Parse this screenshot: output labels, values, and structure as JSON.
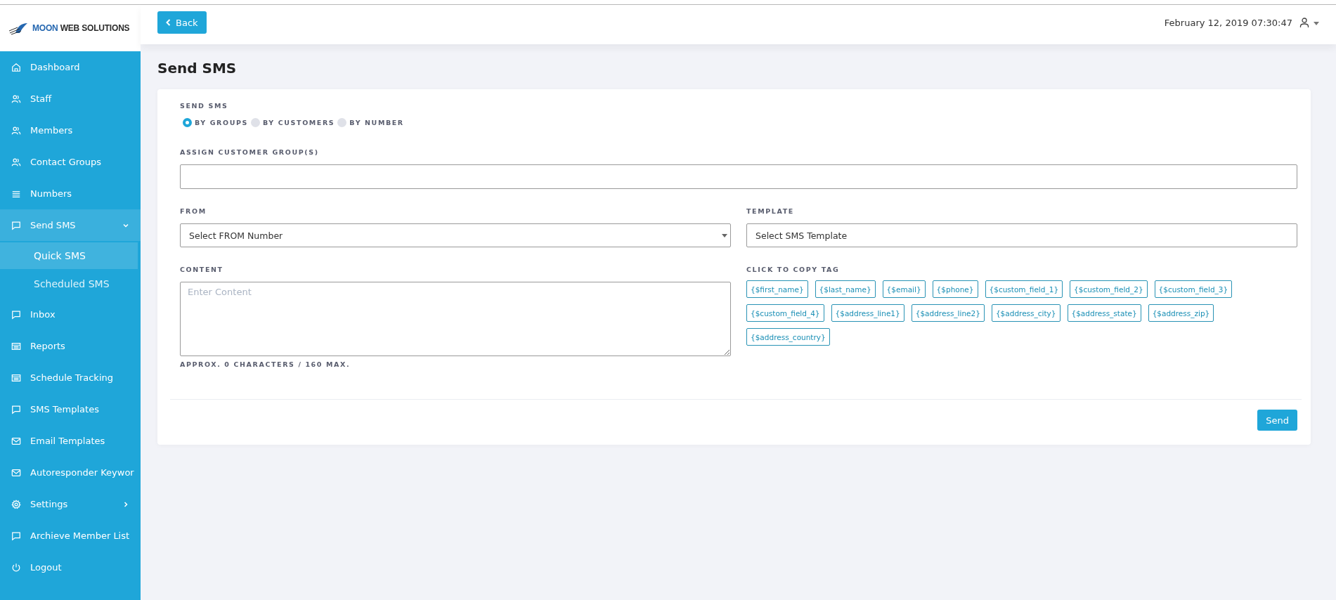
{
  "logo": {
    "brand": "MOON",
    "rest": "WEB SOLUTIONS"
  },
  "header": {
    "back_button": "Back",
    "datetime": "February 12, 2019 07:30:47"
  },
  "sidebar": {
    "items": [
      {
        "label": "Dashboard",
        "kind": "home",
        "selected": false
      },
      {
        "label": "Staff",
        "kind": "users",
        "selected": false
      },
      {
        "label": "Members",
        "kind": "users",
        "selected": false
      },
      {
        "label": "Contact Groups",
        "kind": "users",
        "selected": false
      },
      {
        "label": "Numbers",
        "kind": "lines",
        "selected": false
      },
      {
        "label": "Send SMS",
        "kind": "chat",
        "selected": true,
        "expanded": true,
        "children": [
          {
            "label": "Quick SMS",
            "selected": true
          },
          {
            "label": "Scheduled SMS",
            "selected": false
          }
        ]
      },
      {
        "label": "Inbox",
        "kind": "chat",
        "selected": false
      },
      {
        "label": "Reports",
        "kind": "table",
        "selected": false
      },
      {
        "label": "Schedule Tracking",
        "kind": "table",
        "selected": false
      },
      {
        "label": "SMS Templates",
        "kind": "chat",
        "selected": false
      },
      {
        "label": "Email Templates",
        "kind": "mail",
        "selected": false
      },
      {
        "label": "Autoresponder Keywor",
        "kind": "mail",
        "selected": false
      },
      {
        "label": "Settings",
        "kind": "gear",
        "selected": false,
        "expanded": false
      },
      {
        "label": "Archieve Member List",
        "kind": "chat",
        "selected": false
      },
      {
        "label": "Logout",
        "kind": "power",
        "selected": false
      }
    ]
  },
  "page": {
    "title": "Send SMS"
  },
  "form": {
    "mode_label": "SEND SMS",
    "modes": [
      {
        "label": "BY GROUPS",
        "selected": true
      },
      {
        "label": "BY CUSTOMERS",
        "selected": false
      },
      {
        "label": "BY NUMBER",
        "selected": false
      }
    ],
    "group_label": "ASSIGN CUSTOMER GROUP(S)",
    "from_label": "FROM",
    "from_select": "Select FROM Number",
    "template_label": "TEMPLATE",
    "template_select": "Select SMS Template",
    "content_label": "CONTENT",
    "content_placeholder": "Enter Content",
    "counter": "APPROX. 0 CHARACTERS / 160 MAX.",
    "tags_label": "CLICK TO COPY TAG",
    "tags": [
      "{$first_name}",
      "{$last_name}",
      "{$email}",
      "{$phone}",
      "{$custom_field_1}",
      "{$custom_field_2}",
      "{$custom_field_3}",
      "{$custom_field_4}",
      "{$address_line1}",
      "{$address_line2}",
      "{$address_city}",
      "{$address_state}",
      "{$address_zip}",
      "{$address_country}"
    ],
    "send_button": "Send"
  }
}
